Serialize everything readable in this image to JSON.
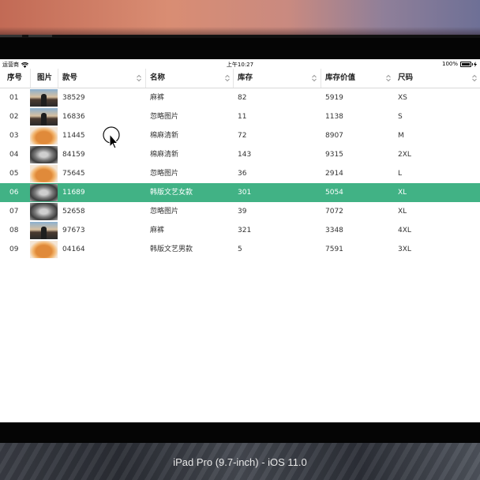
{
  "simulator": {
    "device_name": "iPad Pro (9.7-inch) - iOS 11.0"
  },
  "status_bar": {
    "carrier": "运营商",
    "time": "上午10:27",
    "battery": "100%"
  },
  "table": {
    "columns": [
      {
        "label": "序号",
        "sortable": false
      },
      {
        "label": "图片",
        "sortable": false
      },
      {
        "label": "款号",
        "sortable": true
      },
      {
        "label": "名称",
        "sortable": true
      },
      {
        "label": "库存",
        "sortable": true
      },
      {
        "label": "库存价值",
        "sortable": true
      },
      {
        "label": "尺码",
        "sortable": true
      }
    ],
    "selected_index": 5,
    "selected_color": "#41b285",
    "rows": [
      {
        "index": "01",
        "image": "person",
        "code": "38529",
        "name": "麻裤",
        "stock": "82",
        "value": "5919",
        "size": "XS"
      },
      {
        "index": "02",
        "image": "person",
        "code": "16836",
        "name": "忽略图片",
        "stock": "11",
        "value": "1138",
        "size": "S"
      },
      {
        "index": "03",
        "image": "food",
        "code": "11445",
        "name": "棉麻清新",
        "stock": "72",
        "value": "8907",
        "size": "M"
      },
      {
        "index": "04",
        "image": "cat",
        "code": "84159",
        "name": "棉麻清新",
        "stock": "143",
        "value": "9315",
        "size": "2XL"
      },
      {
        "index": "05",
        "image": "food",
        "code": "75645",
        "name": "忽略图片",
        "stock": "36",
        "value": "2914",
        "size": "L"
      },
      {
        "index": "06",
        "image": "cat",
        "code": "11689",
        "name": "韩版文艺女款",
        "stock": "301",
        "value": "5054",
        "size": "XL"
      },
      {
        "index": "07",
        "image": "cat",
        "code": "52658",
        "name": "忽略图片",
        "stock": "39",
        "value": "7072",
        "size": "XL"
      },
      {
        "index": "08",
        "image": "person",
        "code": "97673",
        "name": "麻裤",
        "stock": "321",
        "value": "3348",
        "size": "4XL"
      },
      {
        "index": "09",
        "image": "food",
        "code": "04164",
        "name": "韩版文艺男款",
        "stock": "5",
        "value": "7591",
        "size": "3XL"
      }
    ]
  },
  "icons": {
    "wifi": "wifi-icon",
    "battery": "battery-icon",
    "sort": "sort-arrows-icon",
    "pointer": "mouse-pointer-icon"
  }
}
